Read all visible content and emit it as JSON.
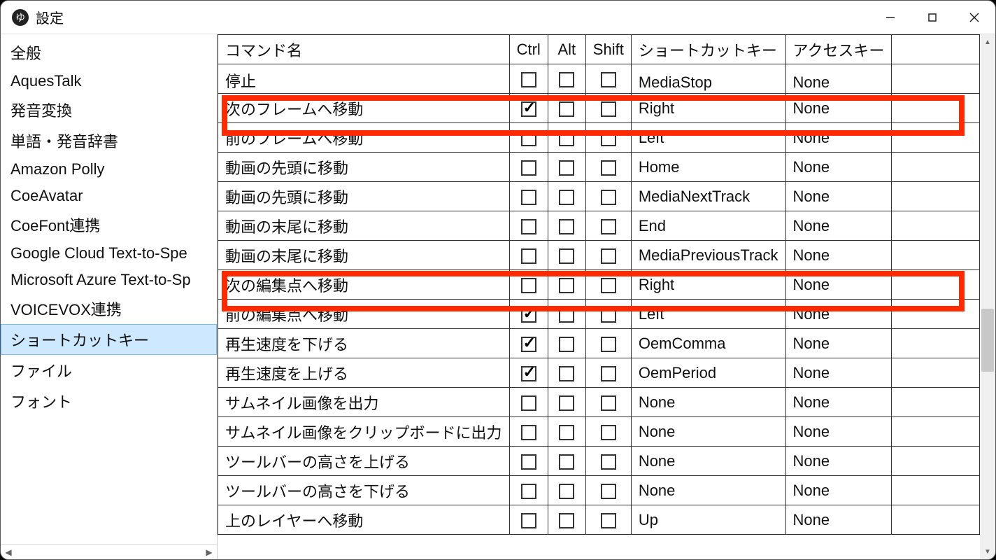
{
  "window": {
    "icon_glyph": "ゆ",
    "title": "設定"
  },
  "sidebar": {
    "items": [
      {
        "label": "全般",
        "selected": false
      },
      {
        "label": "AquesTalk",
        "selected": false
      },
      {
        "label": "発音変換",
        "selected": false
      },
      {
        "label": "単語・発音辞書",
        "selected": false
      },
      {
        "label": "Amazon Polly",
        "selected": false
      },
      {
        "label": "CoeAvatar",
        "selected": false
      },
      {
        "label": "CoeFont連携",
        "selected": false
      },
      {
        "label": "Google Cloud Text-to-Spe",
        "selected": false
      },
      {
        "label": "Microsoft Azure Text-to-Sp",
        "selected": false
      },
      {
        "label": "VOICEVOX連携",
        "selected": false
      },
      {
        "label": "ショートカットキー",
        "selected": true
      },
      {
        "label": "ファイル",
        "selected": false
      },
      {
        "label": "フォント",
        "selected": false
      }
    ]
  },
  "table": {
    "headers": {
      "command": "コマンド名",
      "ctrl": "Ctrl",
      "alt": "Alt",
      "shift": "Shift",
      "shortcut": "ショートカットキー",
      "access": "アクセスキー"
    },
    "rows": [
      {
        "command": "停止",
        "ctrl": false,
        "alt": false,
        "shift": false,
        "shortcut": "MediaStop",
        "access": "None",
        "highlighted": false
      },
      {
        "command": "次のフレームへ移動",
        "ctrl": true,
        "alt": false,
        "shift": false,
        "shortcut": "Right",
        "access": "None",
        "highlighted": true
      },
      {
        "command": "前のフレームへ移動",
        "ctrl": false,
        "alt": false,
        "shift": false,
        "shortcut": "Left",
        "access": "None",
        "highlighted": false
      },
      {
        "command": "動画の先頭に移動",
        "ctrl": false,
        "alt": false,
        "shift": false,
        "shortcut": "Home",
        "access": "None",
        "highlighted": false
      },
      {
        "command": "動画の先頭に移動",
        "ctrl": false,
        "alt": false,
        "shift": false,
        "shortcut": "MediaNextTrack",
        "access": "None",
        "highlighted": false
      },
      {
        "command": "動画の末尾に移動",
        "ctrl": false,
        "alt": false,
        "shift": false,
        "shortcut": "End",
        "access": "None",
        "highlighted": false
      },
      {
        "command": "動画の末尾に移動",
        "ctrl": false,
        "alt": false,
        "shift": false,
        "shortcut": "MediaPreviousTrack",
        "access": "None",
        "highlighted": false
      },
      {
        "command": "次の編集点へ移動",
        "ctrl": false,
        "alt": false,
        "shift": false,
        "shortcut": "Right",
        "access": "None",
        "highlighted": true
      },
      {
        "command": "前の編集点へ移動",
        "ctrl": true,
        "alt": false,
        "shift": false,
        "shortcut": "Left",
        "access": "None",
        "highlighted": false
      },
      {
        "command": "再生速度を下げる",
        "ctrl": true,
        "alt": false,
        "shift": false,
        "shortcut": "OemComma",
        "access": "None",
        "highlighted": false
      },
      {
        "command": "再生速度を上げる",
        "ctrl": true,
        "alt": false,
        "shift": false,
        "shortcut": "OemPeriod",
        "access": "None",
        "highlighted": false
      },
      {
        "command": "サムネイル画像を出力",
        "ctrl": false,
        "alt": false,
        "shift": false,
        "shortcut": "None",
        "access": "None",
        "highlighted": false
      },
      {
        "command": "サムネイル画像をクリップボードに出力",
        "ctrl": false,
        "alt": false,
        "shift": false,
        "shortcut": "None",
        "access": "None",
        "highlighted": false
      },
      {
        "command": "ツールバーの高さを上げる",
        "ctrl": false,
        "alt": false,
        "shift": false,
        "shortcut": "None",
        "access": "None",
        "highlighted": false
      },
      {
        "command": "ツールバーの高さを下げる",
        "ctrl": false,
        "alt": false,
        "shift": false,
        "shortcut": "None",
        "access": "None",
        "highlighted": false
      },
      {
        "command": "上のレイヤーへ移動",
        "ctrl": false,
        "alt": false,
        "shift": false,
        "shortcut": "Up",
        "access": "None",
        "highlighted": false
      }
    ]
  }
}
